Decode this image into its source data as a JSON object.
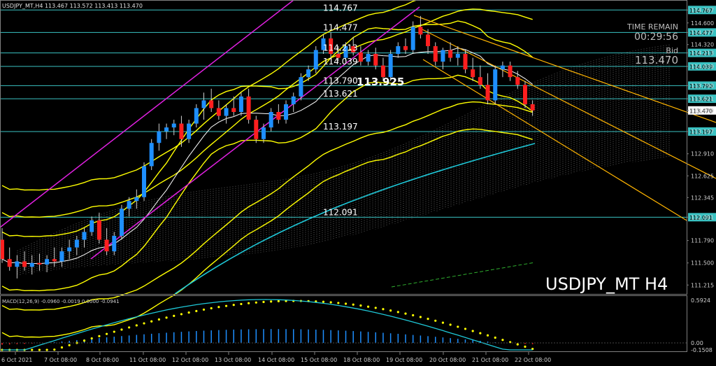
{
  "chart_data": [
    {
      "type": "candlestick",
      "header": "USDJPY_MT,H4  113.467 113.572 113.413 113.470",
      "watermark": "USDJPY_MT H4",
      "info_panel": {
        "label": "TIME REMAIN",
        "time": "00:29:56",
        "bid_label": "Bid",
        "bid": "113.470"
      },
      "big_label": "113.925",
      "ylim": [
        111.1,
        114.86
      ],
      "y_ticks": [
        "114.767",
        "114.477",
        "114.600",
        "114.320",
        "114.213",
        "114.039",
        "113.790",
        "113.621",
        "113.470",
        "113.197",
        "112.910",
        "112.625",
        "112.345",
        "112.091",
        "111.790",
        "111.500",
        "111.215"
      ],
      "x_ticks": [
        "6 Oct 2021",
        "7 Oct 08:00",
        "8 Oct 08:00",
        "11 Oct 08:00",
        "12 Oct 08:00",
        "13 Oct 08:00",
        "14 Oct 08:00",
        "15 Oct 08:00",
        "18 Oct 08:00",
        "19 Oct 08:00",
        "20 Oct 08:00",
        "21 Oct 08:00",
        "22 Oct 08:00"
      ],
      "levels": [
        {
          "value": 114.767,
          "label": "114.767"
        },
        {
          "value": 114.477,
          "label": "114.477"
        },
        {
          "value": 114.213,
          "label": "114.213"
        },
        {
          "value": 114.039,
          "label": "114.039"
        },
        {
          "value": 113.79,
          "label": "113.790"
        },
        {
          "value": 113.621,
          "label": "113.621"
        },
        {
          "value": 113.197,
          "label": "113.197"
        },
        {
          "value": 112.091,
          "label": "112.091"
        }
      ],
      "current_price": {
        "value": 113.47,
        "label": "113.470"
      },
      "colors": {
        "up": "#1e8fff",
        "down": "#ff1f1f",
        "level": "#3ac2c2",
        "bands": "#ffff00",
        "channel": "#e020e0",
        "trend": "#ffb400",
        "sma": "#1ec8d8"
      },
      "candles": [
        [
          111.8,
          111.95,
          111.5,
          111.55
        ],
        [
          111.55,
          111.7,
          111.4,
          111.45
        ],
        [
          111.45,
          111.6,
          111.3,
          111.52
        ],
        [
          111.52,
          111.65,
          111.4,
          111.45
        ],
        [
          111.45,
          111.6,
          111.35,
          111.5
        ],
        [
          111.5,
          111.62,
          111.4,
          111.48
        ],
        [
          111.48,
          111.6,
          111.38,
          111.55
        ],
        [
          111.55,
          111.7,
          111.45,
          111.52
        ],
        [
          111.52,
          111.7,
          111.45,
          111.65
        ],
        [
          111.65,
          111.8,
          111.55,
          111.7
        ],
        [
          111.7,
          111.85,
          111.6,
          111.8
        ],
        [
          111.8,
          111.95,
          111.7,
          111.9
        ],
        [
          111.9,
          112.1,
          111.85,
          112.05
        ],
        [
          112.05,
          112.15,
          111.75,
          111.8
        ],
        [
          111.8,
          111.95,
          111.6,
          111.65
        ],
        [
          111.65,
          111.9,
          111.6,
          111.85
        ],
        [
          111.85,
          112.25,
          111.8,
          112.2
        ],
        [
          112.2,
          112.35,
          112.1,
          112.3
        ],
        [
          112.3,
          112.45,
          112.2,
          112.35
        ],
        [
          112.35,
          112.8,
          112.3,
          112.75
        ],
        [
          112.75,
          113.1,
          112.7,
          113.05
        ],
        [
          113.05,
          113.3,
          112.95,
          113.2
        ],
        [
          113.2,
          113.3,
          113.1,
          113.25
        ],
        [
          113.25,
          113.35,
          113.15,
          113.3
        ],
        [
          113.3,
          113.4,
          113.0,
          113.1
        ],
        [
          113.1,
          113.35,
          113.05,
          113.3
        ],
        [
          113.3,
          113.55,
          113.25,
          113.5
        ],
        [
          113.5,
          113.7,
          113.35,
          113.6
        ],
        [
          113.6,
          113.75,
          113.45,
          113.5
        ],
        [
          113.5,
          113.6,
          113.35,
          113.4
        ],
        [
          113.4,
          113.55,
          113.3,
          113.5
        ],
        [
          113.5,
          113.65,
          113.4,
          113.45
        ],
        [
          113.45,
          113.7,
          113.4,
          113.65
        ],
        [
          113.65,
          113.75,
          113.3,
          113.35
        ],
        [
          113.35,
          113.4,
          113.05,
          113.1
        ],
        [
          113.1,
          113.3,
          113.05,
          113.25
        ],
        [
          113.25,
          113.5,
          113.2,
          113.45
        ],
        [
          113.45,
          113.55,
          113.3,
          113.35
        ],
        [
          113.35,
          113.6,
          113.3,
          113.55
        ],
        [
          113.55,
          113.7,
          113.45,
          113.65
        ],
        [
          113.65,
          113.95,
          113.6,
          113.9
        ],
        [
          113.9,
          114.05,
          113.85,
          114.0
        ],
        [
          114.0,
          114.3,
          113.95,
          114.25
        ],
        [
          114.25,
          114.45,
          114.2,
          114.4
        ],
        [
          114.4,
          114.48,
          114.15,
          114.2
        ],
        [
          114.2,
          114.3,
          114.1,
          114.15
        ],
        [
          114.15,
          114.35,
          114.1,
          114.3
        ],
        [
          114.3,
          114.42,
          114.18,
          114.22
        ],
        [
          114.22,
          114.3,
          114.05,
          114.1
        ],
        [
          114.1,
          114.25,
          114.05,
          114.2
        ],
        [
          114.2,
          114.28,
          114.0,
          114.05
        ],
        [
          114.05,
          114.15,
          113.85,
          113.9
        ],
        [
          113.9,
          114.25,
          113.85,
          114.2
        ],
        [
          114.2,
          114.35,
          114.15,
          114.3
        ],
        [
          114.3,
          114.4,
          114.2,
          114.25
        ],
        [
          114.25,
          114.62,
          114.2,
          114.55
        ],
        [
          114.55,
          114.69,
          114.4,
          114.45
        ],
        [
          114.45,
          114.52,
          114.2,
          114.3
        ],
        [
          114.3,
          114.35,
          114.05,
          114.1
        ],
        [
          114.1,
          114.28,
          114.0,
          114.25
        ],
        [
          114.25,
          114.35,
          114.1,
          114.15
        ],
        [
          114.15,
          114.3,
          114.05,
          114.2
        ],
        [
          114.2,
          114.25,
          113.95,
          114.0
        ],
        [
          114.0,
          114.15,
          113.85,
          113.9
        ],
        [
          113.9,
          114.05,
          113.75,
          113.8
        ],
        [
          113.8,
          113.95,
          113.55,
          113.6
        ],
        [
          113.6,
          114.05,
          113.55,
          114.0
        ],
        [
          114.0,
          114.1,
          113.9,
          114.05
        ],
        [
          114.05,
          114.1,
          113.85,
          113.9
        ],
        [
          113.9,
          113.98,
          113.75,
          113.8
        ],
        [
          113.8,
          113.85,
          113.5,
          113.55
        ],
        [
          113.55,
          113.6,
          113.4,
          113.47
        ]
      ],
      "macd": {
        "label": "MACD(12,26,9) -0.0960 -0.0019 0.0000 -0.0941",
        "ticks": [
          "0.5924",
          "0.00",
          "-0.1508"
        ],
        "ylim": [
          -0.1508,
          0.5924
        ]
      }
    }
  ]
}
